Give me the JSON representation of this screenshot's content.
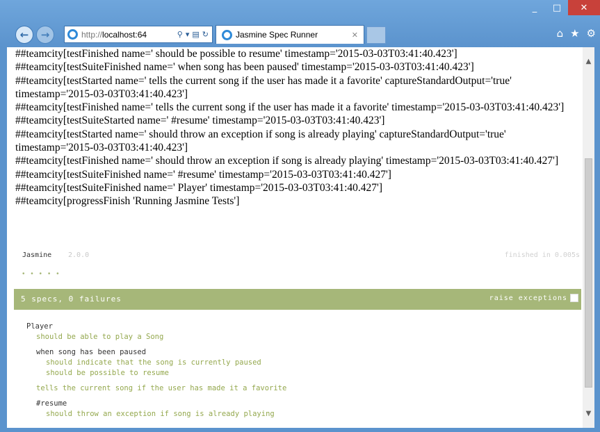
{
  "window": {
    "minimize": "_",
    "maximize": "□",
    "close": "✕"
  },
  "browser": {
    "address": {
      "protocol": "http://",
      "host": "localhost:64",
      "search_icon": "⚲",
      "dropdown": "▾",
      "compat_icon": "▤",
      "refresh_icon": "↻"
    },
    "tab": {
      "title": "Jasmine Spec Runner",
      "close": "✕"
    },
    "icons": [
      "home-icon",
      "favorites-star-icon",
      "settings-gear-icon"
    ],
    "home": "⌂",
    "star": "★",
    "gear": "⚙",
    "back": "←",
    "forward": "→"
  },
  "log_lines": [
    "##teamcity[testFinished name=' should be possible to resume' timestamp='2015-03-03T03:41:40.423']",
    "##teamcity[testSuiteFinished name=' when song has been paused' timestamp='2015-03-03T03:41:40.423']",
    "##teamcity[testStarted name=' tells the current song if the user has made it a favorite' captureStandardOutput='true' timestamp='2015-03-03T03:41:40.423']",
    "##teamcity[testFinished name=' tells the current song if the user has made it a favorite' timestamp='2015-03-03T03:41:40.423']",
    "##teamcity[testSuiteStarted name=' #resume' timestamp='2015-03-03T03:41:40.423']",
    "##teamcity[testStarted name=' should throw an exception if song is already playing' captureStandardOutput='true' timestamp='2015-03-03T03:41:40.423']",
    "##teamcity[testFinished name=' should throw an exception if song is already playing' timestamp='2015-03-03T03:41:40.427']",
    "##teamcity[testSuiteFinished name=' #resume' timestamp='2015-03-03T03:41:40.427']",
    "##teamcity[testSuiteFinished name=' Player' timestamp='2015-03-03T03:41:40.427']",
    "##teamcity[progressFinish 'Running Jasmine Tests']"
  ],
  "jasmine": {
    "title": "Jasmine",
    "version": "2.0.0",
    "duration": "finished in 0.005s",
    "dots": "• • • • •",
    "summary": "5 specs, 0 failures",
    "raise_exceptions_label": "raise exceptions",
    "suite": {
      "name": "Player",
      "specs": [
        "should be able to play a Song"
      ],
      "nested": [
        {
          "name": "when song has been paused",
          "specs": [
            "should indicate that the song is currently paused",
            "should be possible to resume"
          ]
        }
      ],
      "top_spec": "tells the current song if the user has made it a favorite",
      "resume": {
        "name": "#resume",
        "specs": [
          "should throw an exception if song is already playing"
        ]
      }
    }
  },
  "colors": {
    "chrome_blue": "#5b93cd",
    "jasmine_green": "#a6b779",
    "spec_green": "#94a84e",
    "close_red": "#c8413a"
  }
}
